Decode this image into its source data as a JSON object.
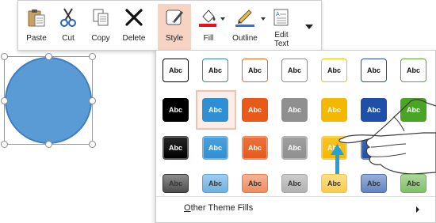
{
  "toolbar": {
    "paste_label": "Paste",
    "cut_label": "Cut",
    "copy_label": "Copy",
    "delete_label": "Delete",
    "style_label": "Style",
    "fill_label": "Fill",
    "outline_label": "Outline",
    "edit_text_label_line1": "Edit",
    "edit_text_label_line2": "Text",
    "fill_color": "#e81123",
    "outline_color": "#2e75d6"
  },
  "gallery": {
    "tile_text": "Abc",
    "selected_tile": "row-2-col-2",
    "outline_colors": [
      "#000000",
      "#2e86c1",
      "#e86a1a",
      "#8c8c8c",
      "#f0c000",
      "#1f4fa8",
      "#5aaa2a"
    ],
    "fill_colors": [
      "#000000",
      "#2e8fd4",
      "#e8591a",
      "#8f8f8f",
      "#f5b800",
      "#1f4fa8",
      "#4aa524"
    ],
    "other_theme_fills_label": "Other Theme Fills",
    "other_theme_fills_accel": "O",
    "other_theme_fills_rest": "ther Theme Fills"
  }
}
